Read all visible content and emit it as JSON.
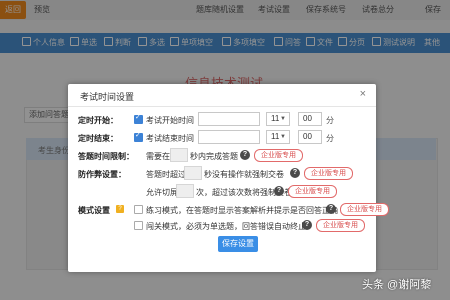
{
  "topbar": {
    "logo_label": "返回",
    "preview": "预览",
    "nav": [
      "题库随机设置",
      "考试设置",
      "保存系统号",
      "试卷总分",
      "保存"
    ]
  },
  "toolbar": {
    "items": [
      "个人信息",
      "单选",
      "判断",
      "多选",
      "单项填空",
      "多项填空",
      "问答",
      "文件",
      "分页",
      "测试说明",
      "其他"
    ]
  },
  "background": {
    "page_title": "信息技术测试",
    "add_label": "添加问答题",
    "panel_text": "考生身份"
  },
  "dialog": {
    "title": "考试时间设置",
    "close": "×",
    "start": {
      "label": "定时开始：",
      "checkbox_text": "考试开始时间",
      "hour": "11",
      "minute": "00",
      "unit": "分"
    },
    "end": {
      "label": "定时结束：",
      "checkbox_text": "考试结束时间",
      "hour": "11",
      "minute": "00",
      "unit": "分"
    },
    "answer_limit": {
      "label": "答题时间限制：",
      "text_before": "需要在",
      "text_after": "秒内完成答题",
      "pro": "企业版专用"
    },
    "anti_cheat": {
      "label": "防作弊设置：",
      "text_before": "答题时超过",
      "text_after": "秒没有操作就强制交卷",
      "pro": "企业版专用",
      "line2_before": "允许切屏",
      "line2_after": "次，超过该次数将强制交卷",
      "pro2": "企业版专用"
    },
    "mode": {
      "label": "模式设置",
      "practice_text": "练习模式，在答题时显示答案解析并提示是否回答正确",
      "pro": "企业版专用",
      "breakthrough_text": "闯关模式，必须为单选题，回答错误自动终止",
      "pro2": "企业版专用"
    },
    "save_button": "保存设置"
  },
  "watermark": "头条 @谢阿黎"
}
